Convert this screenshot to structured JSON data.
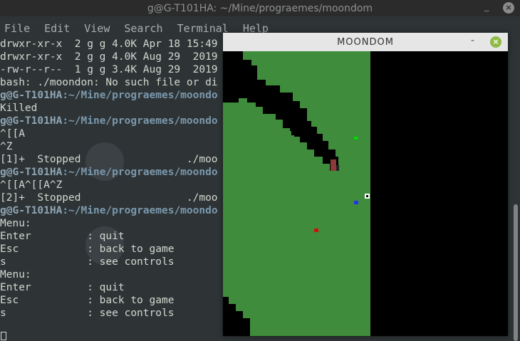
{
  "terminal": {
    "title": "g@G-T101HA: ~/Mine/progra​emes/moondom",
    "controls": {
      "minimize": "_",
      "close": "×"
    },
    "menu": [
      "File",
      "Edit",
      "View",
      "Search",
      "Terminal",
      "Help"
    ],
    "lines": [
      {
        "type": "text",
        "text": "drwxr-xr-x  2 g g 4.0K Apr 18 15:49"
      },
      {
        "type": "text",
        "text": "drwxr-xr-x  2 g g 4.0K Aug 29  2019"
      },
      {
        "type": "text",
        "text": "-rw-r--r--  1 g g 3.4K Aug 29  2019"
      },
      {
        "type": "text",
        "text": "bash: ./moondon: No such file or di"
      },
      {
        "type": "prompt",
        "user": "g@G-T101HA",
        "path": ":~/Mine/progra​emes/moondo"
      },
      {
        "type": "text",
        "text": "Killed"
      },
      {
        "type": "prompt",
        "user": "g@G-T101HA",
        "path": ":~/Mine/progra​emes/moondo"
      },
      {
        "type": "text",
        "text": "^[[A"
      },
      {
        "type": "text",
        "text": "^Z"
      },
      {
        "type": "text",
        "text": "[1]+  Stopped                 ./moo"
      },
      {
        "type": "prompt",
        "user": "g@G-T101HA",
        "path": ":~/Mine/progra​emes/moondo"
      },
      {
        "type": "text",
        "text": "^[[A^[[A^Z"
      },
      {
        "type": "text",
        "text": "[2]+  Stopped                 ./moo"
      },
      {
        "type": "prompt",
        "user": "g@G-T101HA",
        "path": ":~/Mine/progra​emes/moondo"
      },
      {
        "type": "text",
        "text": "Menu:"
      },
      {
        "type": "text",
        "text": "Enter         : quit"
      },
      {
        "type": "text",
        "text": "Esc           : back to game"
      },
      {
        "type": "text",
        "text": "s             : see controls"
      },
      {
        "type": "text",
        "text": "Menu:"
      },
      {
        "type": "text",
        "text": "Enter         : quit"
      },
      {
        "type": "text",
        "text": "Esc           : back to game"
      },
      {
        "type": "text",
        "text": "s             : see controls"
      }
    ]
  },
  "game": {
    "title": "MOONDOM",
    "controls": {
      "minimize": "-",
      "close": "×"
    },
    "colors": {
      "ground": "#3f8c3c",
      "void": "#000000",
      "player": "#ffffff",
      "tree": "#00cc00",
      "enemy_blue": "#2233ee",
      "enemy_red": "#cc1111",
      "block": "#8b3a3a"
    }
  }
}
